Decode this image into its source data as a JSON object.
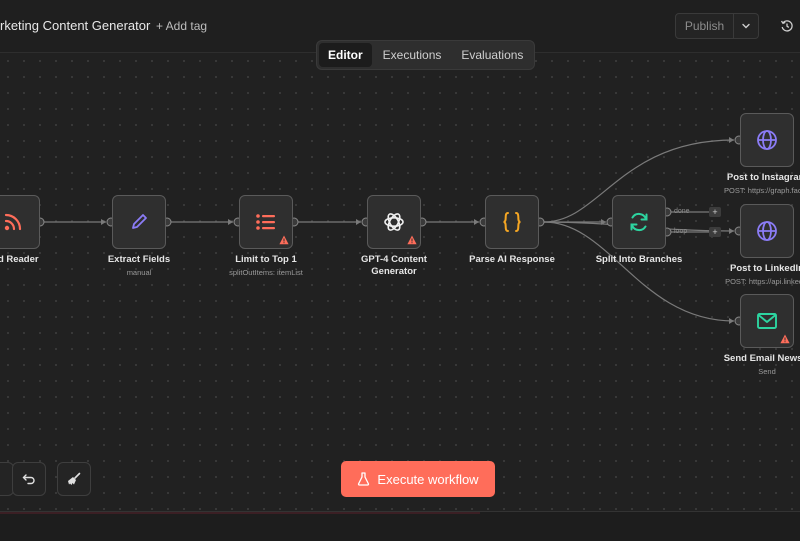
{
  "header": {
    "title": "rketing Content Generator",
    "add_tag": "+ Add tag",
    "publish": "Publish",
    "publish_caret_icon": "chevron-down-icon",
    "history_icon": "history-icon"
  },
  "tabs": [
    {
      "label": "Editor",
      "active": true
    },
    {
      "label": "Executions",
      "active": false
    },
    {
      "label": "Evaluations",
      "active": false
    }
  ],
  "nodes": {
    "rss": {
      "label": "eed Reader",
      "icon": "rss-icon"
    },
    "extract": {
      "label": "Extract Fields",
      "sub": "manual",
      "icon": "pencil-icon"
    },
    "limit": {
      "label": "Limit to Top 1",
      "sub": "splitOutItems: itemList",
      "icon": "list-icon",
      "warning": true
    },
    "gpt": {
      "label_line1": "GPT-4 Content",
      "label_line2": "Generator",
      "icon": "openai-icon",
      "warning": true
    },
    "parse": {
      "label": "Parse AI Response",
      "icon": "braces-icon"
    },
    "split": {
      "label": "Split Into Branches",
      "icon": "refresh-icon",
      "port_done": "done",
      "port_loop": "loop"
    },
    "instagram": {
      "label": "Post to Instagram",
      "sub": "POST: https://graph.faceb",
      "icon": "globe-icon"
    },
    "linkedin": {
      "label": "Post to LinkedIn",
      "sub": "POST: https://api.linkedin",
      "icon": "globe-icon"
    },
    "email": {
      "label": "Send Email Newsle",
      "sub": "Send",
      "icon": "mail-icon",
      "warning": true
    }
  },
  "plus": "+",
  "toolbar": {
    "undo_icon": "undo-icon",
    "clean_icon": "broom-icon",
    "execute_label": "Execute workflow",
    "execute_icon": "flask-icon"
  },
  "colors": {
    "accent": "#ff6d5a",
    "rss": "#ff6d5a",
    "pencil": "#8b7cf6",
    "list": "#ff6d5a",
    "braces": "#f5a623",
    "refresh": "#2dd4a0",
    "globe": "#8b7cf6",
    "mail": "#2dd4a0",
    "warning": "#ff6d5a"
  }
}
